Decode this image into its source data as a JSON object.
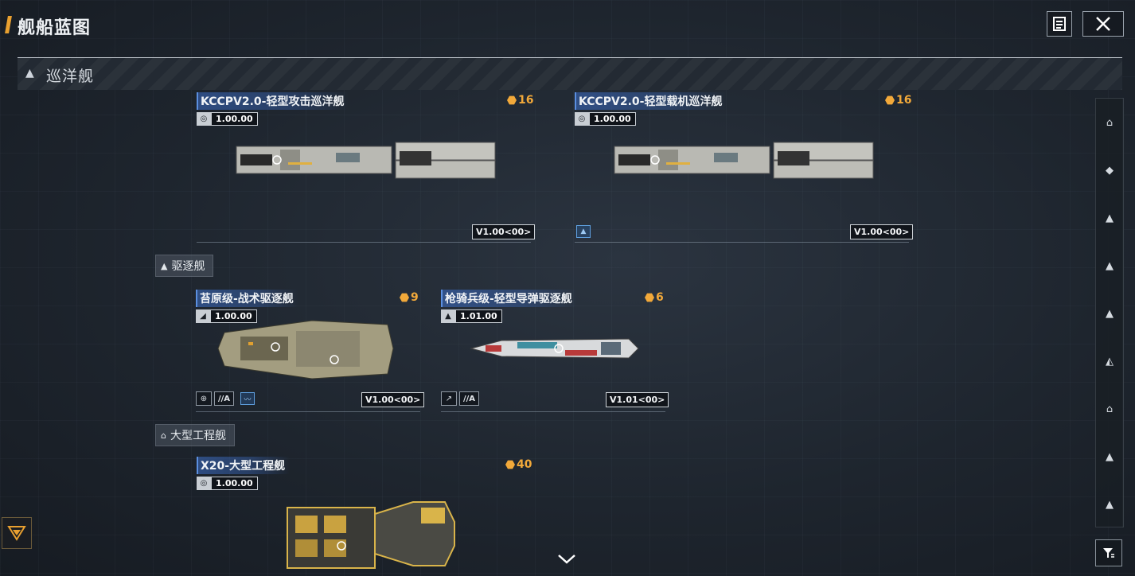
{
  "header": {
    "title": "舰船蓝图",
    "notes_icon": "notes-icon",
    "close_icon": "close-icon"
  },
  "section": {
    "label": "巡洋舰"
  },
  "subsections": {
    "destroyer": "驱逐舰",
    "engineering": "大型工程舰"
  },
  "ships": [
    {
      "name": "KCCPV2.0-轻型攻击巡洋舰",
      "cost": "16",
      "version": "1.00.00",
      "tag": "V1.00<00>"
    },
    {
      "name": "KCCPV2.0-轻型载机巡洋舰",
      "cost": "16",
      "version": "1.00.00",
      "tag": "V1.00<00>"
    },
    {
      "name": "苔原级-战术驱逐舰",
      "cost": "9",
      "version": "1.00.00",
      "tag": "V1.00<00>",
      "class_tag": "//A"
    },
    {
      "name": "枪骑兵级-轻型导弹驱逐舰",
      "cost": "6",
      "version": "1.01.00",
      "tag": "V1.01<00>",
      "class_tag": "//A"
    },
    {
      "name": "X20-大型工程舰",
      "cost": "40",
      "version": "1.00.00"
    }
  ],
  "colors": {
    "accent": "#e8a030",
    "cost": "#f2a93a",
    "name_highlight": "#5b8fe0"
  }
}
